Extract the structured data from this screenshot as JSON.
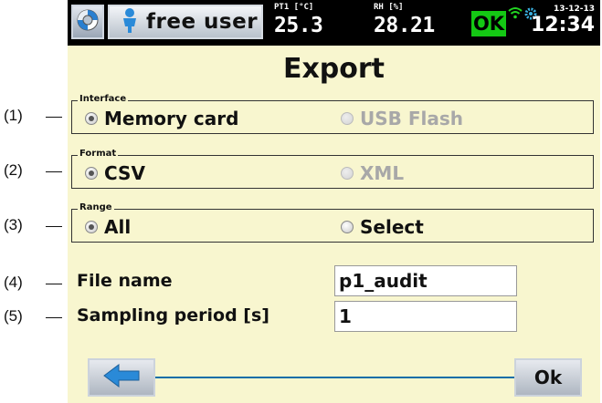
{
  "callouts": [
    "(1)",
    "(2)",
    "(3)",
    "(4)",
    "(5)"
  ],
  "status": {
    "user_label": "free user",
    "pt1_label": "PT1 [°C]",
    "pt1_value": "25.3",
    "rh_label": "RH [%]",
    "rh_value": "28.21",
    "ok_label": "OK",
    "date": "13-12-13",
    "time": "12:34",
    "ok_color": "#14c814"
  },
  "title": "Export",
  "interface": {
    "legend": "Interface",
    "options": [
      {
        "label": "Memory card",
        "checked": true,
        "enabled": true
      },
      {
        "label": "USB Flash",
        "checked": false,
        "enabled": false
      }
    ]
  },
  "format": {
    "legend": "Format",
    "options": [
      {
        "label": "CSV",
        "checked": true,
        "enabled": true
      },
      {
        "label": "XML",
        "checked": false,
        "enabled": false
      }
    ]
  },
  "range": {
    "legend": "Range",
    "options": [
      {
        "label": "All",
        "checked": true,
        "enabled": true
      },
      {
        "label": "Select",
        "checked": false,
        "enabled": true
      }
    ]
  },
  "file_name": {
    "label": "File name",
    "value": "p1_audit"
  },
  "sampling_period": {
    "label": "Sampling period [s]",
    "value": "1"
  },
  "buttons": {
    "ok_label": "Ok"
  }
}
